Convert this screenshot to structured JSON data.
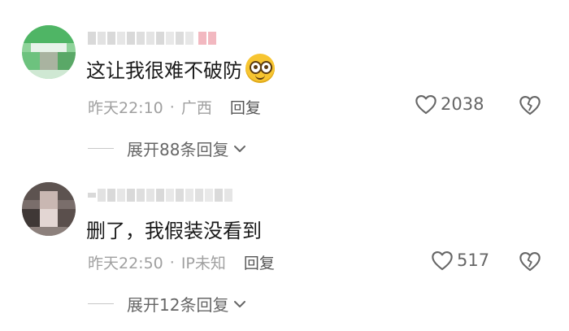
{
  "comments": [
    {
      "text": "这让我很难不破防",
      "time": "昨天22:10",
      "location": "广西",
      "reply_label": "回复",
      "likes": "2038",
      "expand_label": "展开88条回复",
      "has_emoji": true,
      "emoji_name": "astonished-face-icon"
    },
    {
      "text": "删了，我假装没看到",
      "time": "昨天22:50",
      "location": "IP未知",
      "reply_label": "回复",
      "likes": "517",
      "expand_label": "展开12条回复",
      "has_emoji": false
    }
  ],
  "separator": "·",
  "colors": {
    "text_primary": "#1a1a1a",
    "text_meta": "#a0a0a0",
    "text_secondary": "#666666",
    "avatar1_green": "#5bbf6e",
    "emoji_yellow": "#f7c531"
  }
}
